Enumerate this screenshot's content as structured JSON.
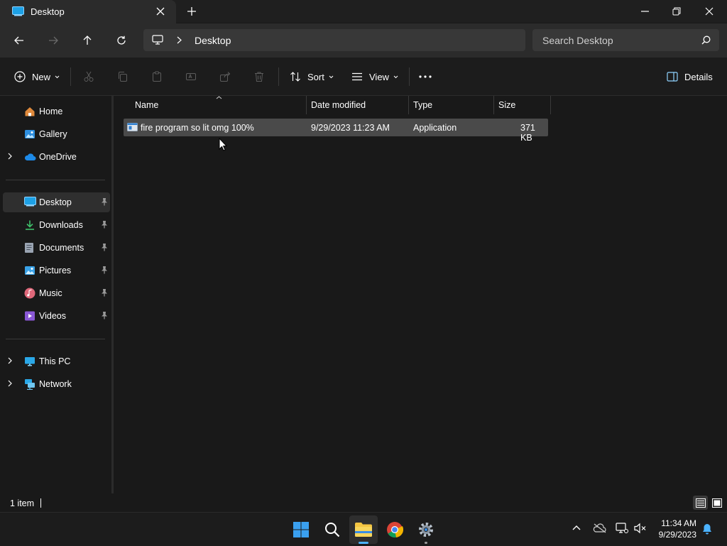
{
  "window": {
    "tab_title": "Desktop",
    "new_tab_icon": "plus-icon"
  },
  "nav": {
    "breadcrumb": [
      "Desktop"
    ],
    "search_placeholder": "Search Desktop"
  },
  "command_bar": {
    "new_label": "New",
    "sort_label": "Sort",
    "view_label": "View",
    "details_label": "Details"
  },
  "sidebar": {
    "quick": [
      {
        "label": "Home",
        "icon": "home-icon"
      },
      {
        "label": "Gallery",
        "icon": "gallery-icon"
      },
      {
        "label": "OneDrive",
        "icon": "cloud-icon"
      }
    ],
    "pinned": [
      {
        "label": "Desktop",
        "icon": "desktop-icon",
        "selected": true
      },
      {
        "label": "Downloads",
        "icon": "download-icon"
      },
      {
        "label": "Documents",
        "icon": "document-icon"
      },
      {
        "label": "Pictures",
        "icon": "picture-icon"
      },
      {
        "label": "Music",
        "icon": "music-icon"
      },
      {
        "label": "Videos",
        "icon": "video-icon"
      }
    ],
    "locations": [
      {
        "label": "This PC",
        "icon": "pc-icon"
      },
      {
        "label": "Network",
        "icon": "network-icon"
      }
    ]
  },
  "columns": {
    "name": "Name",
    "date": "Date modified",
    "type": "Type",
    "size": "Size"
  },
  "files": [
    {
      "name": "fire program so lit omg 100%",
      "date": "9/29/2023 11:23 AM",
      "type": "Application",
      "size": "371 KB"
    }
  ],
  "status": {
    "count": "1 item"
  },
  "taskbar": {
    "time": "11:34 AM",
    "date": "9/29/2023"
  },
  "colors": {
    "accent": "#0078d4",
    "folder": "#f4c542",
    "selection": "#4a4a4a"
  }
}
